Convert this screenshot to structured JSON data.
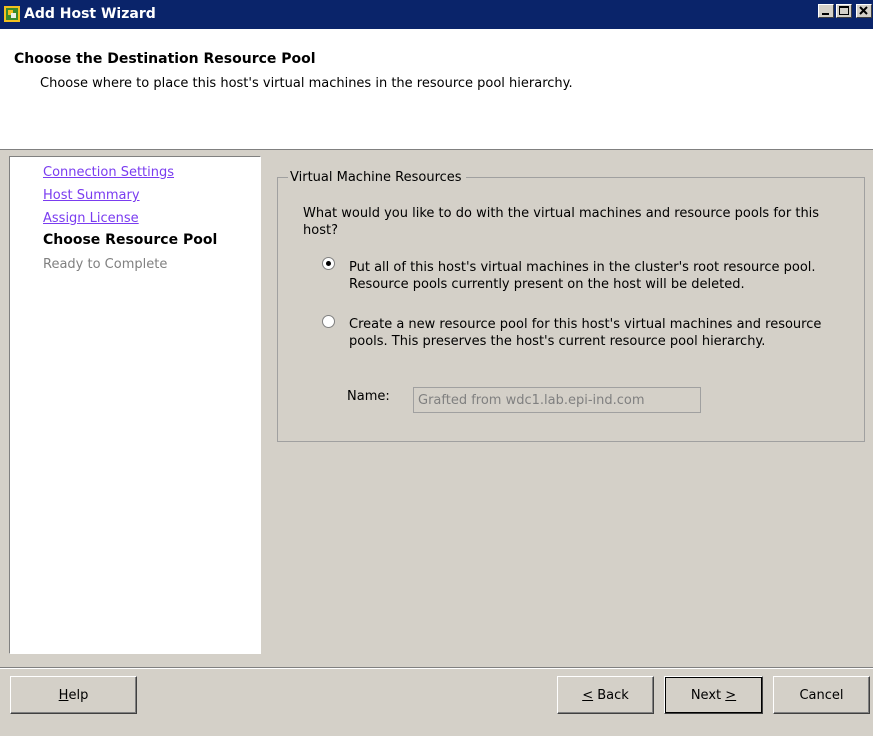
{
  "window": {
    "title": "Add Host Wizard",
    "icon": "vsphere-host-add-icon"
  },
  "header": {
    "title": "Choose the Destination Resource Pool",
    "subtitle": "Choose where to place this host's virtual machines in the resource pool hierarchy."
  },
  "nav": {
    "items": [
      {
        "label": "Connection Settings",
        "state": "link"
      },
      {
        "label": "Host Summary",
        "state": "link"
      },
      {
        "label": "Assign License",
        "state": "link"
      },
      {
        "label": "Choose Resource Pool",
        "state": "current"
      },
      {
        "label": "Ready to Complete",
        "state": "future"
      }
    ]
  },
  "group": {
    "legend": "Virtual Machine Resources",
    "question": "What would you like to do with the virtual machines and resource pools for this host?",
    "options": [
      {
        "label": "Put all of this host's virtual machines in the cluster's root resource pool. Resource pools currently present on the host will be deleted.",
        "checked": true
      },
      {
        "label": "Create a new resource pool for this host's virtual machines and resource pools.  This preserves the host's current resource pool hierarchy.",
        "checked": false
      }
    ],
    "name_label": "Name:",
    "name_value": "Grafted from wdc1.lab.epi-ind.com"
  },
  "buttons": {
    "help_mnemonic": "H",
    "help_rest": "elp",
    "back_mnemonic": "<",
    "back_rest": " Back",
    "next_prefix": "Next ",
    "next_mnemonic": ">",
    "cancel": "Cancel"
  },
  "colors": {
    "titlebar": "#0a246a",
    "link": "#7a3cf0",
    "disabled_text": "#808080",
    "dialog_bg": "#d4d0c8"
  }
}
